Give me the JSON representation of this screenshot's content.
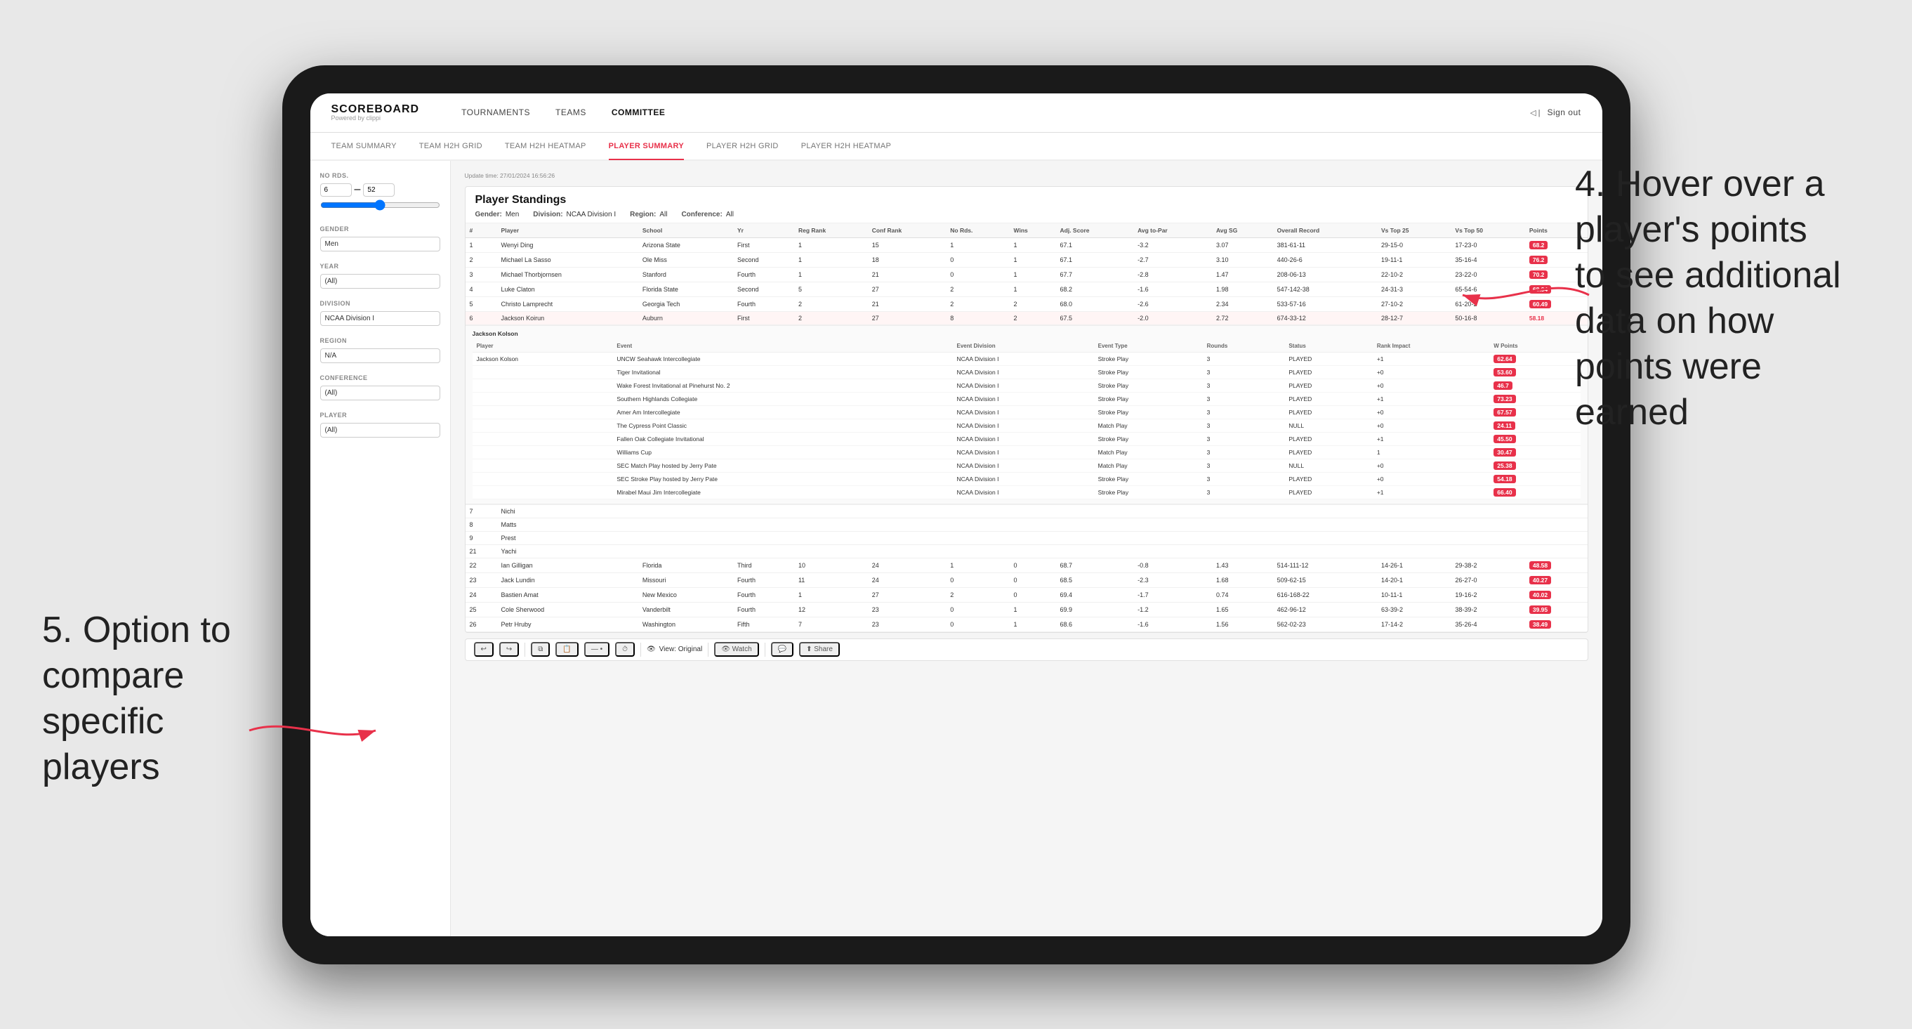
{
  "page": {
    "background": "#e8e8e8"
  },
  "annotations": {
    "right": {
      "number": "4.",
      "text": "Hover over a player's points to see additional data on how points were earned"
    },
    "left": {
      "number": "5.",
      "text": "Option to compare specific players"
    }
  },
  "navbar": {
    "logo": "SCOREBOARD",
    "logo_sub": "Powered by clippi",
    "links": [
      "TOURNAMENTS",
      "TEAMS",
      "COMMITTEE"
    ],
    "active_link": "COMMITTEE",
    "sign_out": "Sign out"
  },
  "subtabs": {
    "tabs": [
      "TEAM SUMMARY",
      "TEAM H2H GRID",
      "TEAM H2H HEATMAP",
      "PLAYER SUMMARY",
      "PLAYER H2H GRID",
      "PLAYER H2H HEATMAP"
    ],
    "active": "PLAYER SUMMARY"
  },
  "sidebar": {
    "no_rds_label": "No Rds.",
    "no_rds_from": "6",
    "no_rds_to": "52",
    "gender_label": "Gender",
    "gender_value": "Men",
    "year_label": "Year",
    "year_value": "(All)",
    "division_label": "Division",
    "division_value": "NCAA Division I",
    "region_label": "Region",
    "region_value": "N/A",
    "conference_label": "Conference",
    "conference_value": "(All)",
    "player_label": "Player",
    "player_value": "(All)"
  },
  "table": {
    "title": "Player Standings",
    "update_time": "Update time: 27/01/2024 16:56:26",
    "filters": {
      "gender": "Men",
      "division": "NCAA Division I",
      "region": "All",
      "conference": "All"
    },
    "columns": [
      "#",
      "Player",
      "School",
      "Yr",
      "Reg Rank",
      "Conf Rank",
      "No Rds.",
      "Wins",
      "Adj. Score",
      "Avg to-Par",
      "Avg SG",
      "Overall Record",
      "Vs Top 25",
      "Vs Top 50",
      "Points"
    ],
    "rows": [
      {
        "rank": 1,
        "player": "Wenyi Ding",
        "school": "Arizona State",
        "yr": "First",
        "reg_rank": 1,
        "conf_rank": 15,
        "no_rds": 1,
        "wins": 1,
        "adj_score": 67.1,
        "avg_to_par": -3.2,
        "avg_sg": 3.07,
        "overall": "381-61-11",
        "vs_top25": "29-15-0",
        "vs_top50": "17-23-0",
        "points": "68.2",
        "points_color": "red"
      },
      {
        "rank": 2,
        "player": "Michael La Sasso",
        "school": "Ole Miss",
        "yr": "Second",
        "reg_rank": 1,
        "conf_rank": 18,
        "no_rds": 0,
        "wins": 1,
        "adj_score": 67.1,
        "avg_to_par": -2.7,
        "avg_sg": 3.1,
        "overall": "440-26-6",
        "vs_top25": "19-11-1",
        "vs_top50": "35-16-4",
        "points": "76.2",
        "points_color": "red"
      },
      {
        "rank": 3,
        "player": "Michael Thorbjornsen",
        "school": "Stanford",
        "yr": "Fourth",
        "reg_rank": 1,
        "conf_rank": 21,
        "no_rds": 0,
        "wins": 1,
        "adj_score": 67.7,
        "avg_to_par": -2.8,
        "avg_sg": 1.47,
        "overall": "208-06-13",
        "vs_top25": "22-10-2",
        "vs_top50": "23-22-0",
        "points": "70.2",
        "points_color": "red"
      },
      {
        "rank": 4,
        "player": "Luke Claton",
        "school": "Florida State",
        "yr": "Second",
        "reg_rank": 5,
        "conf_rank": 27,
        "no_rds": 2,
        "wins": 1,
        "adj_score": 68.2,
        "avg_to_par": -1.6,
        "avg_sg": 1.98,
        "overall": "547-142-38",
        "vs_top25": "24-31-3",
        "vs_top50": "65-54-6",
        "points": "68.34",
        "points_color": "red"
      },
      {
        "rank": 5,
        "player": "Christo Lamprecht",
        "school": "Georgia Tech",
        "yr": "Fourth",
        "reg_rank": 2,
        "conf_rank": 21,
        "no_rds": 2,
        "wins": 2,
        "adj_score": 68.0,
        "avg_to_par": -2.6,
        "avg_sg": 2.34,
        "overall": "533-57-16",
        "vs_top25": "27-10-2",
        "vs_top50": "61-20-2",
        "points": "60.49",
        "points_color": "red"
      },
      {
        "rank": 6,
        "player": "Jackson Koirun",
        "school": "Auburn",
        "yr": "First",
        "reg_rank": 2,
        "conf_rank": 27,
        "no_rds": 8,
        "wins": 2,
        "adj_score": 67.5,
        "avg_to_par": -2.0,
        "avg_sg": 2.72,
        "overall": "674-33-12",
        "vs_top25": "28-12-7",
        "vs_top50": "50-16-8",
        "points": "58.18",
        "points_color": "normal"
      },
      {
        "rank": 7,
        "player": "Nichi",
        "school": "",
        "yr": "",
        "reg_rank": null,
        "conf_rank": null,
        "no_rds": null,
        "wins": null,
        "adj_score": null,
        "avg_to_par": null,
        "avg_sg": null,
        "overall": "",
        "vs_top25": "",
        "vs_top50": "",
        "points": "",
        "points_color": "normal"
      },
      {
        "rank": 8,
        "player": "Matts",
        "school": "",
        "yr": "",
        "reg_rank": null,
        "conf_rank": null,
        "no_rds": null,
        "wins": null,
        "adj_score": null,
        "avg_to_par": null,
        "avg_sg": null,
        "overall": "",
        "vs_top25": "",
        "vs_top50": "",
        "points": "",
        "points_color": "normal"
      },
      {
        "rank": 9,
        "player": "Prest",
        "school": "",
        "yr": "",
        "reg_rank": null,
        "conf_rank": null,
        "no_rds": null,
        "wins": null,
        "adj_score": null,
        "avg_to_par": null,
        "avg_sg": null,
        "overall": "",
        "vs_top25": "",
        "vs_top50": "",
        "points": "",
        "points_color": "normal"
      }
    ],
    "jackson_tooltip": {
      "player": "Jackson Kolson",
      "events": [
        {
          "event": "UNCW Seahawk Intercollegiate",
          "division": "NCAA Division I",
          "type": "Stroke Play",
          "rounds": 3,
          "status": "PLAYED",
          "rank_impact": "+1",
          "points": "62.64"
        },
        {
          "event": "Tiger Invitational",
          "division": "NCAA Division I",
          "type": "Stroke Play",
          "rounds": 3,
          "status": "PLAYED",
          "rank_impact": "+0",
          "points": "53.60"
        },
        {
          "event": "Wake Forest Invitational at Pinehurst No. 2",
          "division": "NCAA Division I",
          "type": "Stroke Play",
          "rounds": 3,
          "status": "PLAYED",
          "rank_impact": "+0",
          "points": "46.7"
        },
        {
          "event": "Southern Highlands Collegiate",
          "division": "NCAA Division I",
          "type": "Stroke Play",
          "rounds": 3,
          "status": "PLAYED",
          "rank_impact": "+1",
          "points": "73.23"
        },
        {
          "event": "Amer Am Intercollegiate",
          "division": "NCAA Division I",
          "type": "Stroke Play",
          "rounds": 3,
          "status": "PLAYED",
          "rank_impact": "+0",
          "points": "67.57"
        },
        {
          "event": "The Cypress Point Classic",
          "division": "NCAA Division I",
          "type": "Match Play",
          "rounds": 3,
          "status": "NULL",
          "rank_impact": "+0",
          "points": "24.11"
        },
        {
          "event": "Fallen Oak Collegiate Invitational",
          "division": "NCAA Division I",
          "type": "Stroke Play",
          "rounds": 3,
          "status": "PLAYED",
          "rank_impact": "+1",
          "points": "45.50"
        },
        {
          "event": "Williams Cup",
          "division": "NCAA Division I",
          "type": "Match Play",
          "rounds": 3,
          "status": "PLAYED",
          "rank_impact": "1",
          "points": "30.47"
        },
        {
          "event": "SEC Match Play hosted by Jerry Pate",
          "division": "NCAA Division I",
          "type": "Match Play",
          "rounds": 3,
          "status": "NULL",
          "rank_impact": "+0",
          "points": "25.38"
        },
        {
          "event": "SEC Stroke Play hosted by Jerry Pate",
          "division": "NCAA Division I",
          "type": "Stroke Play",
          "rounds": 3,
          "status": "PLAYED",
          "rank_impact": "+0",
          "points": "54.18"
        },
        {
          "event": "Mirabel Maui Jim Intercollegiate",
          "division": "NCAA Division I",
          "type": "Stroke Play",
          "rounds": 3,
          "status": "PLAYED",
          "rank_impact": "+1",
          "points": "66.40"
        }
      ]
    },
    "more_rows": [
      {
        "rank": 21,
        "player": "Yachi",
        "school": "",
        "yr": "",
        "reg_rank": null,
        "conf_rank": null,
        "no_rds": null,
        "wins": null,
        "adj_score": null,
        "avg_to_par": null,
        "avg_sg": null,
        "overall": "",
        "vs_top25": "",
        "vs_top50": "",
        "points": ""
      },
      {
        "rank": 22,
        "player": "Ian Gilligan",
        "school": "Florida",
        "yr": "Third",
        "reg_rank": 10,
        "conf_rank": 24,
        "no_rds": 1,
        "wins": 0,
        "adj_score": 68.7,
        "avg_to_par": -0.8,
        "avg_sg": 1.43,
        "overall": "514-111-12",
        "vs_top25": "14-26-1",
        "vs_top50": "29-38-2",
        "points": "48.58"
      },
      {
        "rank": 23,
        "player": "Jack Lundin",
        "school": "Missouri",
        "yr": "Fourth",
        "reg_rank": 11,
        "conf_rank": 24,
        "no_rds": 0,
        "wins": 0,
        "adj_score": 68.5,
        "avg_to_par": -2.3,
        "avg_sg": 1.68,
        "overall": "509-62-15",
        "vs_top25": "14-20-1",
        "vs_top50": "26-27-0",
        "points": "40.27"
      },
      {
        "rank": 24,
        "player": "Bastien Amat",
        "school": "New Mexico",
        "yr": "Fourth",
        "reg_rank": 1,
        "conf_rank": 27,
        "no_rds": 2,
        "wins": 0,
        "adj_score": 69.4,
        "avg_to_par": -1.7,
        "avg_sg": 0.74,
        "overall": "616-168-22",
        "vs_top25": "10-11-1",
        "vs_top50": "19-16-2",
        "points": "40.02"
      },
      {
        "rank": 25,
        "player": "Cole Sherwood",
        "school": "Vanderbilt",
        "yr": "Fourth",
        "reg_rank": 12,
        "conf_rank": 23,
        "no_rds": 0,
        "wins": 1,
        "adj_score": 69.9,
        "avg_to_par": -1.2,
        "avg_sg": 1.65,
        "overall": "462-96-12",
        "vs_top25": "63-39-2",
        "vs_top50": "38-39-2",
        "points": "39.95"
      },
      {
        "rank": 26,
        "player": "Petr Hruby",
        "school": "Washington",
        "yr": "Fifth",
        "reg_rank": 7,
        "conf_rank": 23,
        "no_rds": 0,
        "wins": 1,
        "adj_score": 68.6,
        "avg_to_par": -1.6,
        "avg_sg": 1.56,
        "overall": "562-02-23",
        "vs_top25": "17-14-2",
        "vs_top50": "35-26-4",
        "points": "38.49"
      }
    ]
  },
  "toolbar": {
    "undo": "↩",
    "redo": "↪",
    "view_original": "View: Original",
    "watch": "Watch",
    "share": "Share"
  }
}
